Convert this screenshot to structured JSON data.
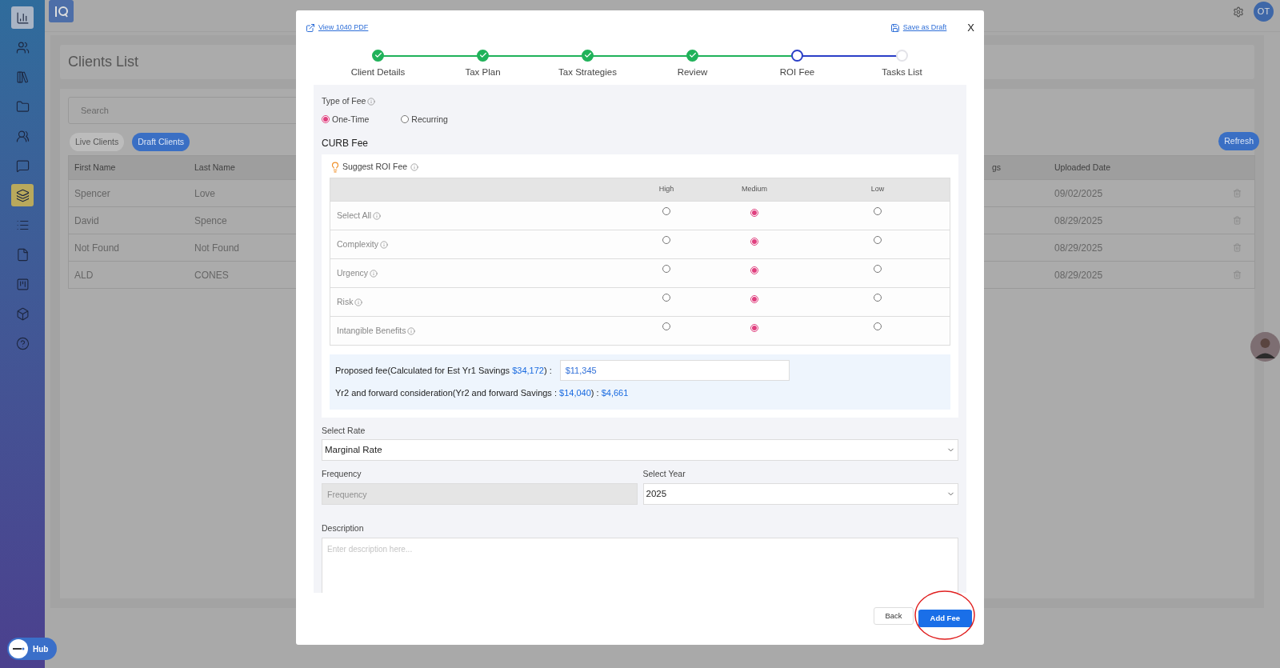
{
  "sidebar": {
    "items": [
      {
        "kind": "chart",
        "selected": false
      },
      {
        "kind": "users",
        "selected": false
      },
      {
        "kind": "library",
        "selected": false
      },
      {
        "kind": "folder",
        "selected": false
      },
      {
        "kind": "team",
        "selected": false
      },
      {
        "kind": "chat",
        "selected": false
      },
      {
        "kind": "layers",
        "selected": true
      },
      {
        "kind": "list",
        "selected": false
      },
      {
        "kind": "file",
        "selected": false
      },
      {
        "kind": "kanban",
        "selected": false
      },
      {
        "kind": "box",
        "selected": false
      },
      {
        "kind": "help",
        "selected": false
      }
    ],
    "hub_button": "Hub"
  },
  "top_bar": {
    "user_avatar": "OT"
  },
  "page": {
    "title": "Clients List",
    "search": {
      "placeholder": "Search"
    },
    "tabs": [
      {
        "label": "Live Clients",
        "selected": false
      },
      {
        "label": "Draft Clients",
        "selected": true
      }
    ],
    "refresh_button": "Refresh",
    "table": {
      "columns": [
        "First Name",
        "Last Name",
        "gs",
        "Uploaded Date"
      ],
      "rows": [
        {
          "first_name": "Spencer",
          "last_name": "Love",
          "uploaded_date": "09/02/2025"
        },
        {
          "first_name": "David",
          "last_name": "Spence",
          "uploaded_date": "08/29/2025"
        },
        {
          "first_name": "Not Found",
          "last_name": "Not Found",
          "uploaded_date": "08/29/2025"
        },
        {
          "first_name": "ALD",
          "last_name": "CONES",
          "uploaded_date": "08/29/2025"
        }
      ]
    }
  },
  "modal": {
    "view_pdf_link": "View 1040 PDF",
    "save_draft_link": "Save as Draft",
    "close_button": "X",
    "steps": [
      {
        "label": "Client Details",
        "done": true,
        "current": false
      },
      {
        "label": "Tax Plan",
        "done": true,
        "current": false
      },
      {
        "label": "Tax Strategies",
        "done": true,
        "current": false
      },
      {
        "label": "Review",
        "done": true,
        "current": false
      },
      {
        "label": "ROI Fee",
        "done": false,
        "current": true
      },
      {
        "label": "Tasks List",
        "done": false,
        "current": false
      }
    ],
    "type_of_fee": {
      "label": "Type of Fee",
      "options": [
        {
          "label": "One-Time",
          "selected": true
        },
        {
          "label": "Recurring",
          "selected": false
        }
      ]
    },
    "section_title": "CURB Fee",
    "suggest_title": "Suggest ROI Fee",
    "fee_table": {
      "columns": [
        "High",
        "Medium",
        "Low"
      ],
      "rows": [
        {
          "label": "Select All",
          "choices": [
            {
              "selected": false
            },
            {
              "selected": true
            },
            {
              "selected": false
            }
          ]
        },
        {
          "label": "Complexity",
          "choices": [
            {
              "selected": false
            },
            {
              "selected": true
            },
            {
              "selected": false
            }
          ]
        },
        {
          "label": "Urgency",
          "choices": [
            {
              "selected": false
            },
            {
              "selected": true
            },
            {
              "selected": false
            }
          ]
        },
        {
          "label": "Risk",
          "choices": [
            {
              "selected": false
            },
            {
              "selected": true
            },
            {
              "selected": false
            }
          ]
        },
        {
          "label": "Intangible Benefits",
          "choices": [
            {
              "selected": false
            },
            {
              "selected": true
            },
            {
              "selected": false
            }
          ]
        }
      ]
    },
    "proposed": {
      "label_start": "Proposed fee(Calculated for Est Yr1 Savings ",
      "yr1_savings": "$34,172",
      "label_end": ") :",
      "fee_value": "$11,345"
    },
    "yr2": {
      "label_start": "Yr2 and forward consideration(Yr2 and forward Savings : ",
      "savings": "$14,040",
      "label_end": ") : ",
      "fee": "$4,661"
    },
    "select_rate": {
      "label": "Select Rate",
      "value": "Marginal Rate"
    },
    "frequency": {
      "label": "Frequency",
      "placeholder": "Frequency",
      "disabled": true
    },
    "select_year": {
      "label": "Select Year",
      "value": "2025"
    },
    "description": {
      "label": "Description",
      "placeholder": "Enter description here..."
    },
    "buttons": {
      "back": "Back",
      "add": "Add Fee"
    }
  }
}
